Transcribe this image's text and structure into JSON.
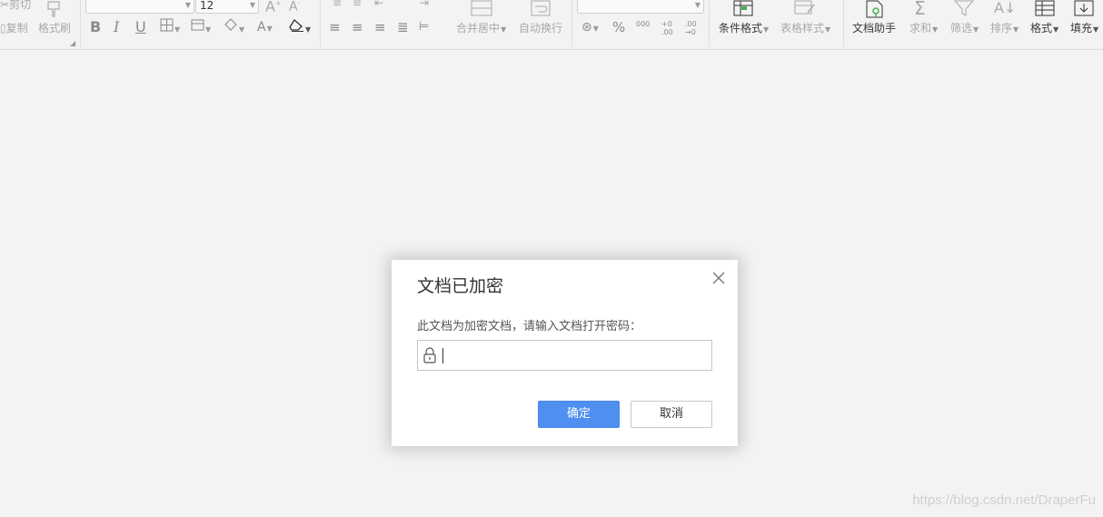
{
  "toolbar": {
    "cut_label": "剪切",
    "copy_label": "复制",
    "format_painter_label": "格式刷",
    "font_size_value": "12",
    "merge_center_label": "合并居中",
    "wrap_text_label": "自动换行",
    "number_buttons": {
      "percent": "%",
      "thousands": "000",
      "increase_decimal": "+0 .00",
      "decrease_decimal": ".00 →0"
    },
    "conditional_format_label": "条件格式",
    "table_style_label": "表格样式",
    "doc_assistant_label": "文档助手",
    "sum_label": "求和",
    "filter_label": "筛选",
    "sort_label": "排序",
    "format_label": "格式",
    "fill_label": "填充"
  },
  "dialog": {
    "title": "文档已加密",
    "message": "此文档为加密文档，请输入文档打开密码：",
    "password_value": "",
    "ok_label": "确定",
    "cancel_label": "取消"
  },
  "watermark": "https://blog.csdn.net/DraperFu"
}
